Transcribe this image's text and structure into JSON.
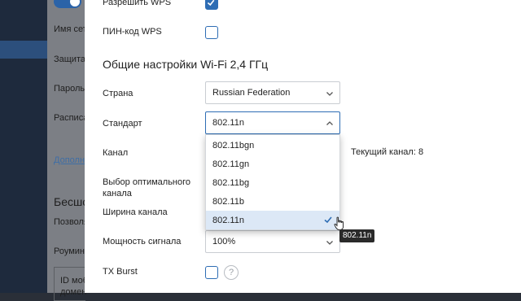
{
  "background": {
    "items": [
      "Имя сет",
      "Защита",
      "Пароль",
      "Расписа",
      "Дополн",
      "Бесшо",
      "Позволя",
      "Роумин",
      "ID моб",
      "домен"
    ]
  },
  "panel": {
    "wps_label": "Разрешить WPS",
    "wps_enabled": true,
    "pin_label": "ПИН-код WPS",
    "pin_enabled": false,
    "section_title": "Общие настройки Wi-Fi 2,4 ГГц",
    "country_label": "Страна",
    "country_value": "Russian Federation",
    "standard_label": "Стандарт",
    "standard_value": "802.11n",
    "channel_label": "Канал",
    "current_channel": "Текущий канал: 8",
    "optimal_label_1": "Выбор оптимального",
    "optimal_label_2": "канала",
    "width_label": "Ширина канала",
    "power_label": "Мощность сигнала",
    "power_value": "100%",
    "txburst_label": "TX Burst",
    "txburst_enabled": false,
    "help_icon": "?"
  },
  "dropdown": {
    "options": [
      "802.11bgn",
      "802.11gn",
      "802.11bg",
      "802.11b",
      "802.11n"
    ],
    "selected": "802.11n"
  },
  "tooltip": "802.11n",
  "colors": {
    "accent": "#2e6db4",
    "selected_row": "#dce8f6",
    "tooltip_bg": "#2a2a2a"
  }
}
